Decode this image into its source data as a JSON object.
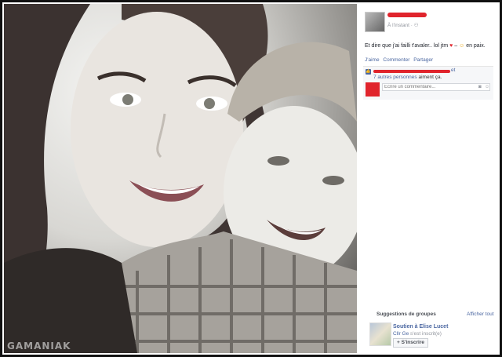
{
  "post": {
    "timestamp": "À l'instant",
    "audience_icon": "friends-icon",
    "caption": "Et dire que j'ai failli t'avaler.. lol jtm",
    "emoji_heart": "heart-icon",
    "emoji_smiley": "smiley-icon",
    "caption_suffix": "en paix."
  },
  "actions": {
    "like": "J'aime",
    "comment": "Commenter",
    "share": "Partager"
  },
  "likes": {
    "connector": "et",
    "others_link": "7 autres personnes",
    "others_suffix": "aiment ça."
  },
  "comment_box": {
    "placeholder": "Écrire un commentaire..."
  },
  "suggestions": {
    "title": "Suggestions de groupes",
    "see_all": "Afficher tout",
    "group_name": "Soutien à Elise Lucet",
    "member_name": "Cllr Ge",
    "member_suffix": "s'est inscrit(e)",
    "join_label": "S'inscrire"
  },
  "watermark": "GAMANIAK",
  "colors": {
    "link": "#4b67a1",
    "redaction": "#e0242c",
    "muted": "#90949c"
  }
}
